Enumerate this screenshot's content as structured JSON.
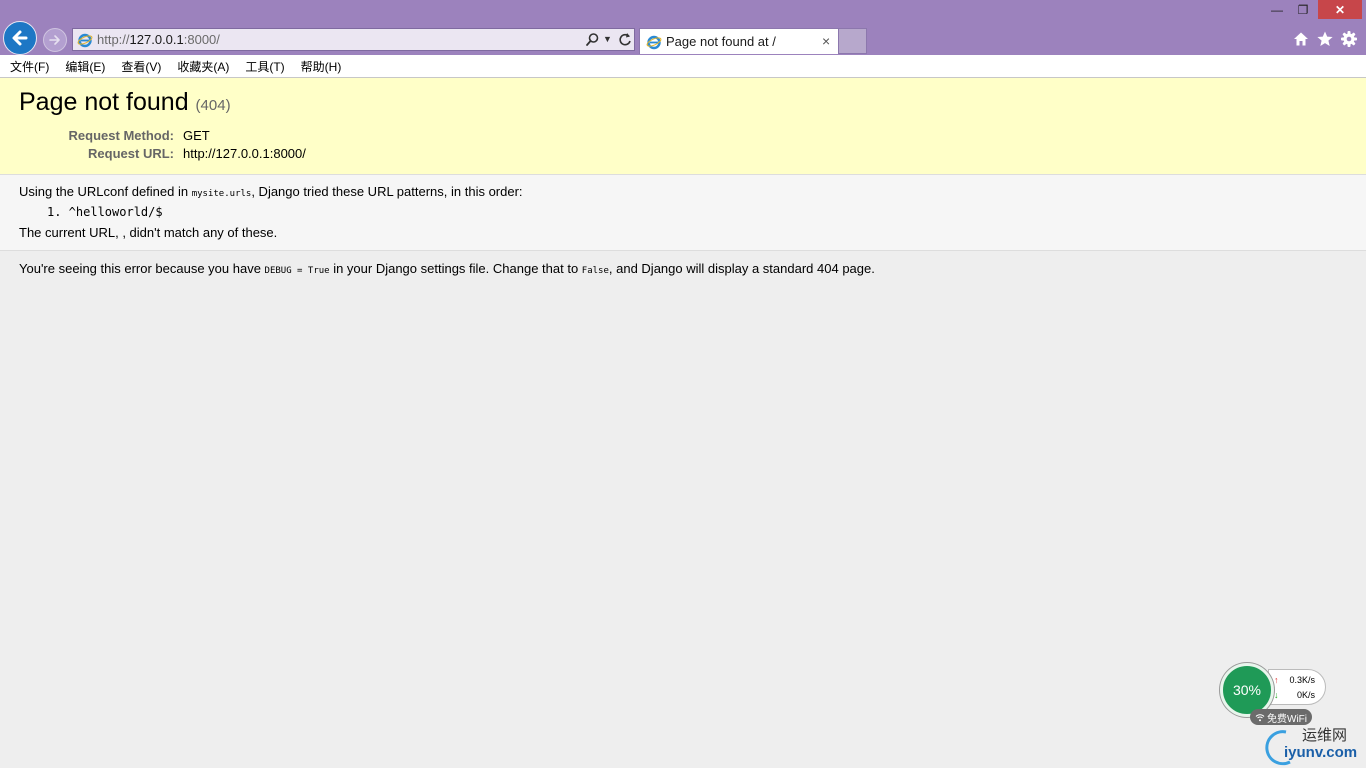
{
  "browser": {
    "address_prefix": "http://",
    "address_host": "127.0.0.1",
    "address_suffix": ":8000/",
    "tab_title": "Page not found at /",
    "tab_close": "×",
    "window_min": "—",
    "window_max": "❐",
    "window_close": "✕",
    "menu": [
      "文件(F)",
      "编辑(E)",
      "查看(V)",
      "收藏夹(A)",
      "工具(T)",
      "帮助(H)"
    ]
  },
  "error": {
    "title": "Page not found",
    "code": "(404)",
    "request_method_label": "Request Method:",
    "request_method_value": "GET",
    "request_url_label": "Request URL:",
    "request_url_value": "http://127.0.0.1:8000/"
  },
  "info": {
    "line1_pre": "Using the URLconf defined in ",
    "line1_code": "mysite.urls",
    "line1_post": ", Django tried these URL patterns, in this order:",
    "pattern_item": "1.  ^helloworld/$",
    "line3": "The current URL, , didn't match any of these."
  },
  "explanation": {
    "pre": "You're seeing this error because you have ",
    "code1": "DEBUG = True",
    "mid": " in your Django settings file. Change that to ",
    "code2": "False",
    "post": ", and Django will display a standard 404 page."
  },
  "widget": {
    "percent": "30%",
    "up_arrow": "↑",
    "down_arrow": "↓",
    "up_speed": "0.3K/s",
    "down_speed": "0K/s",
    "wifi_label": "免费WiFi"
  },
  "watermark": {
    "cn": "运维网",
    "en": "iyunv.com"
  },
  "colors": {
    "titlebar": "#9c82bd",
    "back_button": "#1d77c5",
    "close_button": "#c7464a",
    "summary_bg": "#ffffc8",
    "widget_green": "#1f9a57"
  },
  "icons": [
    "back-arrow-icon",
    "forward-arrow-icon",
    "ie-logo-icon",
    "search-icon",
    "refresh-icon",
    "home-icon",
    "star-icon",
    "gear-icon"
  ]
}
